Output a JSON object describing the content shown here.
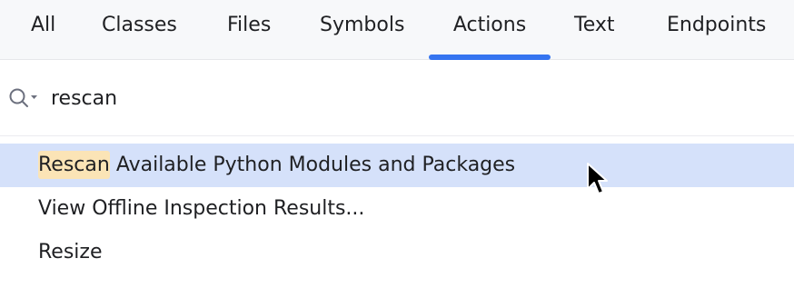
{
  "tabs": [
    {
      "label": "All"
    },
    {
      "label": "Classes"
    },
    {
      "label": "Files"
    },
    {
      "label": "Symbols"
    },
    {
      "label": "Actions",
      "active": true
    },
    {
      "label": "Text"
    },
    {
      "label": "Endpoints"
    }
  ],
  "search": {
    "value": "rescan",
    "icon": "search-options-icon"
  },
  "results": [
    {
      "match": "Rescan",
      "rest": " Available Python Modules and Packages",
      "selected": true
    },
    {
      "label": "View Offline Inspection Results..."
    },
    {
      "label": "Resize"
    }
  ],
  "colors": {
    "accent": "#3574f0",
    "selection": "#d5e1fa",
    "match_highlight": "#fbe4b6",
    "tabbar_bg": "#f7f8fa"
  }
}
